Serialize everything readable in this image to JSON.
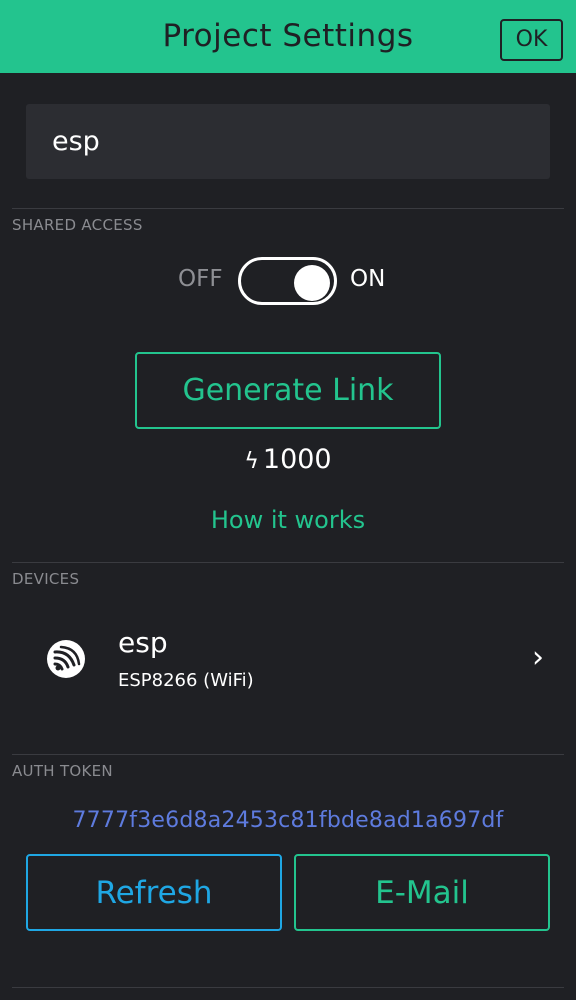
{
  "header": {
    "title": "Project Settings",
    "ok_label": "OK"
  },
  "project": {
    "name": "esp"
  },
  "shared_access": {
    "section_label": "SHARED ACCESS",
    "toggle_off_label": "OFF",
    "toggle_on_label": "ON",
    "toggle_state": "on",
    "generate_label": "Generate Link",
    "energy_icon": "bolt-icon",
    "energy_value": "1000",
    "how_it_works_label": "How it works"
  },
  "devices": {
    "section_label": "DEVICES",
    "items": [
      {
        "name": "esp",
        "type": "ESP8266 (WiFi)",
        "icon": "espressif-logo-icon"
      }
    ]
  },
  "auth_token": {
    "section_label": "AUTH TOKEN",
    "value": "7777f3e6d8a2453c81fbde8ad1a697df",
    "refresh_label": "Refresh",
    "email_label": "E-Mail"
  },
  "colors": {
    "accent": "#23c48e",
    "background": "#1f2024",
    "link_blue": "#5e7bde",
    "refresh_blue": "#1fa7e4"
  }
}
